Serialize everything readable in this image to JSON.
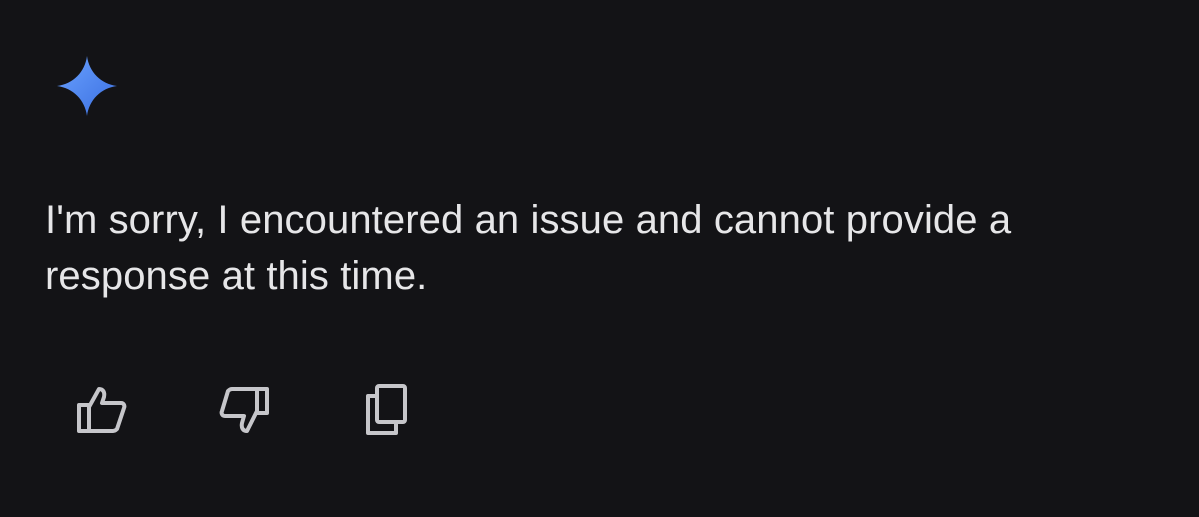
{
  "response": {
    "text": "I'm sorry, I encountered an issue and cannot provide a response at this time.",
    "avatar_icon": "sparkle-icon"
  },
  "actions": {
    "thumbs_up_icon": "thumbs-up-icon",
    "thumbs_down_icon": "thumbs-down-icon",
    "copy_icon": "copy-icon"
  },
  "colors": {
    "background": "#131316",
    "text": "#e6e6e8",
    "icon": "#c6c6ca",
    "sparkle_top": "#5b95f7",
    "sparkle_bottom": "#3b6fe0"
  }
}
